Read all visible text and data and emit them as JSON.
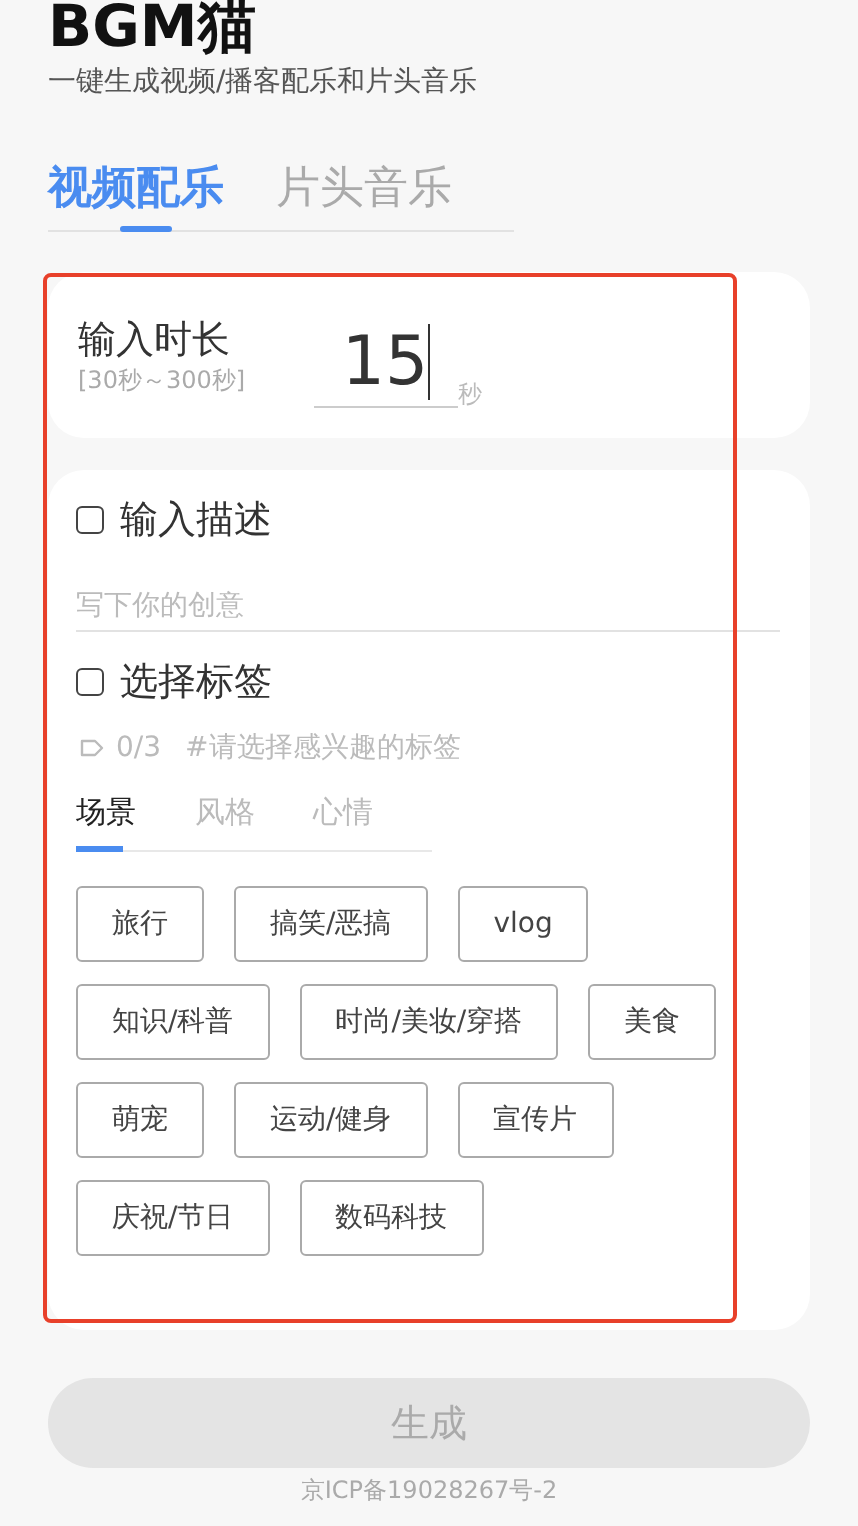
{
  "app": {
    "title": "BGM猫",
    "subtitle": "一键生成视频/播客配乐和片头音乐"
  },
  "tabs": [
    {
      "label": "视频配乐",
      "selected": true
    },
    {
      "label": "片头音乐",
      "selected": false
    }
  ],
  "duration": {
    "label": "输入时长",
    "hint": "[30秒～300秒]",
    "value": "15",
    "unit": "秒"
  },
  "description": {
    "label": "输入描述",
    "checked": false,
    "placeholder": "写下你的创意"
  },
  "tag_select": {
    "label": "选择标签",
    "checked": false,
    "count": "0/3",
    "hint": "#请选择感兴趣的标签"
  },
  "tag_tabs": [
    {
      "label": "场景",
      "selected": true
    },
    {
      "label": "风格",
      "selected": false
    },
    {
      "label": "心情",
      "selected": false
    }
  ],
  "tags": [
    {
      "label": "旅行",
      "selected": false
    },
    {
      "label": "搞笑/恶搞",
      "selected": false
    },
    {
      "label": "vlog",
      "selected": false
    },
    {
      "label": "知识/科普",
      "selected": false
    },
    {
      "label": "时尚/美妆/穿搭",
      "selected": false
    },
    {
      "label": "美食",
      "selected": false
    },
    {
      "label": "萌宠",
      "selected": false
    },
    {
      "label": "运动/健身",
      "selected": false
    },
    {
      "label": "宣传片",
      "selected": false
    },
    {
      "label": "庆祝/节日",
      "selected": false
    },
    {
      "label": "数码科技",
      "selected": false
    }
  ],
  "generate_button": {
    "label": "生成",
    "disabled": true
  },
  "footer": "京ICP备19028267号-2"
}
